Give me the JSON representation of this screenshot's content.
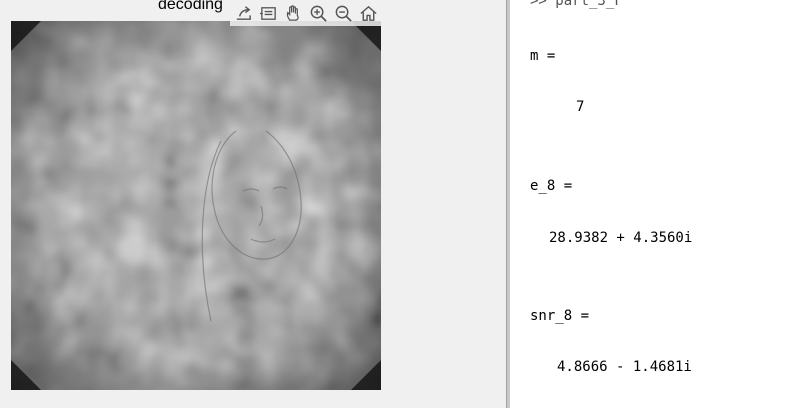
{
  "figure": {
    "title": "decoding",
    "toolbar": [
      {
        "name": "export-icon"
      },
      {
        "name": "data-tips-icon"
      },
      {
        "name": "pan-hand-icon"
      },
      {
        "name": "zoom-in-icon"
      },
      {
        "name": "zoom-out-icon"
      },
      {
        "name": "home-icon"
      }
    ]
  },
  "command_window": {
    "prompt": ">> part_3_F",
    "lines": [
      {
        "label": "m =",
        "value": "7"
      },
      {
        "label": "e_8 =",
        "value": "28.9382 + 4.3560i"
      },
      {
        "label": "snr_8 =",
        "value": "4.8666 - 1.4681i"
      }
    ]
  }
}
